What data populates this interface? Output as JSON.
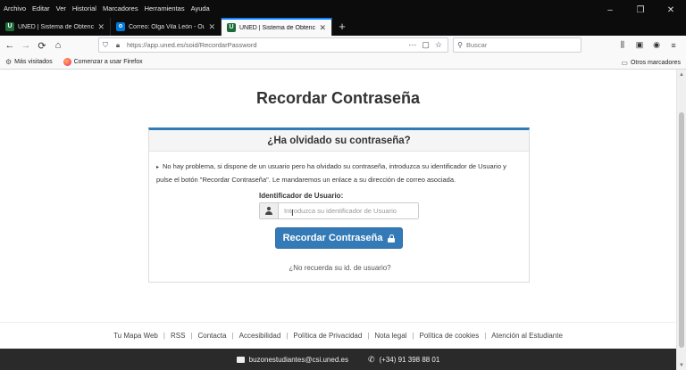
{
  "menu": [
    "Archivo",
    "Editar",
    "Ver",
    "Historial",
    "Marcadores",
    "Herramientas",
    "Ayuda"
  ],
  "window_controls": {
    "minimize": "‒",
    "maximize": "❐",
    "close": "✕"
  },
  "tabs": [
    {
      "favicon": "U",
      "favicon_color": "#1d6b3a",
      "title": "UNED | Sistema de Obtención d",
      "active": false
    },
    {
      "favicon": "o",
      "favicon_color": "#0078d4",
      "title": "Correo: Olga Vila León - Outlo",
      "active": false
    },
    {
      "favicon": "U",
      "favicon_color": "#1d6b3a",
      "title": "UNED | Sistema de Obtención d",
      "active": true
    }
  ],
  "new_tab_symbol": "+",
  "nav": {
    "back": "←",
    "forward": "→",
    "reload": "⟳",
    "home": "⌂"
  },
  "url": {
    "value": "https://app.uned.es/soid/RecordarPassword",
    "actions": [
      "⋯",
      "▢",
      "☆"
    ]
  },
  "search": {
    "placeholder": "Buscar"
  },
  "toolbar_icons": [
    "library-icon",
    "sidebar-icon",
    "account-icon",
    "menu-icon"
  ],
  "bookmarks": {
    "most_visited": "Más visitados",
    "getting_started": "Comenzar a usar Firefox",
    "other": "Otros marcadores"
  },
  "page": {
    "title": "Recordar Contraseña",
    "panel_heading": "¿Ha olvidado su contraseña?",
    "info_text": "No hay problema, si dispone de un usuario pero ha olvidado su contraseña, introduzca su identificador de Usuario y pulse el botón \"Recordar Contraseña\". Le mandaremos un enlace a su dirección de correo asociada.",
    "id_label": "Identificador de Usuario:",
    "id_placeholder": "Introduzca su identificador de Usuario",
    "submit_label": "Recordar Contraseña",
    "forgot_link": "¿No recuerda su id. de usuario?"
  },
  "footer": {
    "links": [
      "Tu Mapa Web",
      "RSS",
      "Contacta",
      "Accesibilidad",
      "Política de Privacidad",
      "Nota legal",
      "Política de cookies",
      "Atención al Estudiante"
    ],
    "email": "buzonestudiantes@csi.uned.es",
    "phone": "(+34) 91 398 88 01"
  },
  "colors": {
    "primary_button": "#337ab7",
    "tab_strip": "#0c0c0d",
    "footer_dark": "#2a2a2a"
  }
}
